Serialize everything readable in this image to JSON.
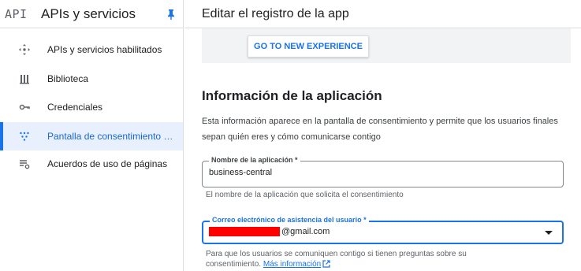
{
  "sidebar": {
    "logo": "API",
    "title": "APIs y servicios",
    "items": [
      {
        "label": "APIs y servicios habilitados",
        "icon": "apis-icon",
        "active": false
      },
      {
        "label": "Biblioteca",
        "icon": "library-icon",
        "active": false
      },
      {
        "label": "Credenciales",
        "icon": "key-icon",
        "active": false
      },
      {
        "label": "Pantalla de consentimiento de OAuth",
        "icon": "consent-icon",
        "active": true
      },
      {
        "label": "Acuerdos de uso de páginas",
        "icon": "agreements-icon",
        "active": false
      }
    ]
  },
  "header": {
    "title": "Editar el registro de la app"
  },
  "banner": {
    "button_label": "GO TO NEW EXPERIENCE"
  },
  "section": {
    "title": "Información de la aplicación",
    "description": "Esta información aparece en la pantalla de consentimiento y permite que los usuarios finales sepan quién eres y cómo comunicarse contigo"
  },
  "form": {
    "app_name": {
      "label": "Nombre de la aplicación *",
      "value": "business-central",
      "hint": "El nombre de la aplicación que solicita el consentimiento"
    },
    "support_email": {
      "label": "Correo electrónico de asistencia del usuario *",
      "value_suffix": "@gmail.com",
      "hint_text": "Para que los usuarios se comuniquen contigo si tienen preguntas sobre su consentimiento.",
      "hint_link": "Más información"
    }
  },
  "colors": {
    "accent": "#1a73e8",
    "active_bg": "#e8f0fe",
    "redaction": "#ff0000"
  }
}
